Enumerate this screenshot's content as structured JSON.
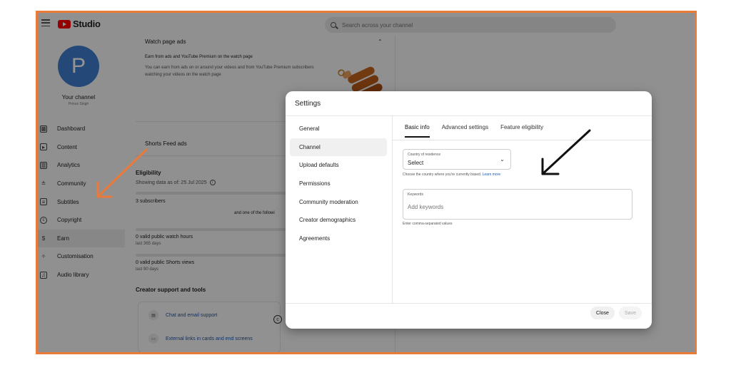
{
  "app": {
    "logo_text": "Studio"
  },
  "search": {
    "placeholder": "Search across your channel"
  },
  "channel": {
    "avatar_letter": "P",
    "title": "Your channel",
    "name": "Prince Singh"
  },
  "sidebar": {
    "items": [
      {
        "label": "Dashboard",
        "icon": "dashboard-icon"
      },
      {
        "label": "Content",
        "icon": "content-icon"
      },
      {
        "label": "Analytics",
        "icon": "analytics-icon"
      },
      {
        "label": "Community",
        "icon": "community-icon"
      },
      {
        "label": "Subtitles",
        "icon": "subtitles-icon"
      },
      {
        "label": "Copyright",
        "icon": "copyright-icon"
      },
      {
        "label": "Earn",
        "icon": "earn-icon"
      },
      {
        "label": "Customisation",
        "icon": "customisation-icon"
      },
      {
        "label": "Audio library",
        "icon": "audio-library-icon"
      }
    ]
  },
  "main": {
    "watch_page_ads": {
      "title": "Watch page ads",
      "subtitle": "Earn from ads and YouTube Premium on the watch page",
      "description": "You can earn from ads on or around your videos and from YouTube Premium subscribers watching your videos on the watch page"
    },
    "shorts_feed_ads": {
      "title": "Shorts Feed ads"
    },
    "eligibility": {
      "title": "Eligibility",
      "date": "Showing data as of: 25 Jul 2025",
      "subscribers": "3 subscribers",
      "following_text": "and one of the followi",
      "watch_hours": "0 valid public watch hours",
      "watch_hours_period": "last 365 days",
      "shorts_views": "0 valid public Shorts views",
      "shorts_views_period": "last 90 days"
    },
    "creator_support": {
      "title": "Creator support and tools",
      "chat_support": "Chat and email support",
      "external_links": "External links in cards and end screens"
    }
  },
  "dialog": {
    "title": "Settings",
    "nav": [
      "General",
      "Channel",
      "Upload defaults",
      "Permissions",
      "Community moderation",
      "Creator demographics",
      "Agreements"
    ],
    "active_nav": "Channel",
    "tabs": [
      "Basic info",
      "Advanced settings",
      "Feature eligibility"
    ],
    "active_tab": "Basic info",
    "country": {
      "label": "Country of residence",
      "value": "Select",
      "help": "Choose the country where you're currently based.",
      "learn_more": "Learn more"
    },
    "keywords": {
      "label": "Keywords",
      "placeholder": "Add keywords",
      "help": "Enter comma-separated values"
    },
    "close_label": "Close",
    "save_label": "Save"
  },
  "colors": {
    "frame_border": "#ea7a3a",
    "avatar": "#3f7fd1",
    "brand_red": "#ff0000",
    "link": "#1a56b0"
  }
}
